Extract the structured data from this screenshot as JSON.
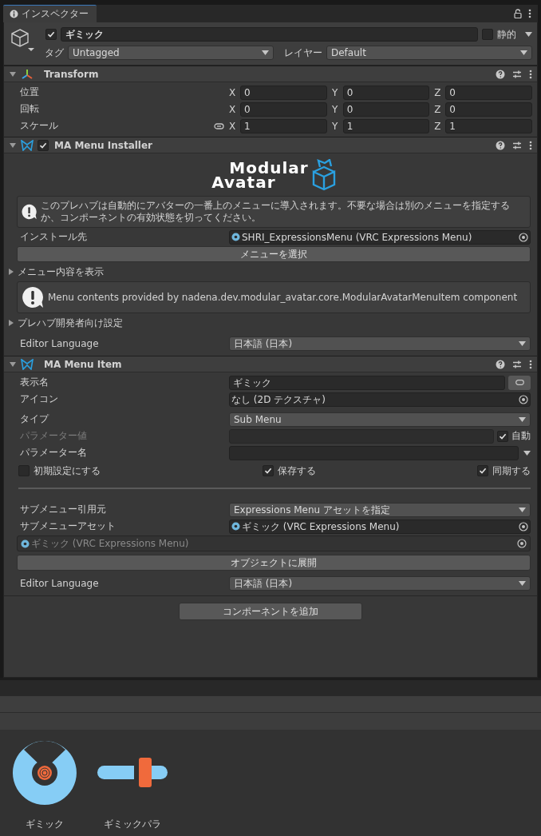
{
  "tab": {
    "title": "インスペクター",
    "selected": true
  },
  "object": {
    "active": true,
    "name": "ギミック",
    "static": false,
    "static_label": "静的",
    "tag_label": "タグ",
    "tag": "Untagged",
    "layer_label": "レイヤー",
    "layer": "Default"
  },
  "components": [
    {
      "kind": "transform",
      "title": "Transform",
      "expanded": true,
      "rows": [
        {
          "kind": "vector",
          "label": "位置",
          "fields": [
            {
              "axis": "X",
              "value": "0"
            },
            {
              "axis": "Y",
              "value": "0"
            },
            {
              "axis": "Z",
              "value": "0"
            }
          ]
        },
        {
          "kind": "vector",
          "label": "回転",
          "fields": [
            {
              "axis": "X",
              "value": "0"
            },
            {
              "axis": "Y",
              "value": "0"
            },
            {
              "axis": "Z",
              "value": "0"
            }
          ]
        },
        {
          "kind": "scale",
          "label": "スケール",
          "fields": [
            {
              "axis": "X",
              "value": "1"
            },
            {
              "axis": "Y",
              "value": "1"
            },
            {
              "axis": "Z",
              "value": "1"
            }
          ]
        }
      ]
    },
    {
      "kind": "modular_avatar",
      "title": "MA Menu Installer",
      "enabled": true,
      "expanded": true,
      "logo": {
        "line1": "Modular",
        "line2": "Avatar"
      },
      "rows": [
        {
          "kind": "help",
          "text": "このプレハブは自動的にアバターの一番上のメニューに導入されます。不要な場合は別のメニューを指定するか、コンポーネントの有効状態を切ってください。"
        },
        {
          "kind": "object_field",
          "label": "インストール先",
          "value": "SHRI_ExpressionsMenu (VRC Expressions Menu)"
        },
        {
          "kind": "button",
          "text": "メニューを選択"
        },
        {
          "kind": "foldout",
          "label": "メニュー内容を表示",
          "expanded": false
        },
        {
          "kind": "help",
          "text": "Menu contents provided by nadena.dev.modular_avatar.core.ModularAvatarMenuItem component"
        },
        {
          "kind": "foldout",
          "label": "プレハブ開発者向け設定",
          "expanded": false
        },
        {
          "kind": "dropdown",
          "label": "Editor Language",
          "value": "日本語 (日本)"
        }
      ]
    },
    {
      "kind": "modular_avatar",
      "title": "MA Menu Item",
      "expanded": true,
      "rows": [
        {
          "kind": "name_field",
          "label": "表示名",
          "value": "ギミック"
        },
        {
          "kind": "texture_field",
          "label": "アイコン",
          "value": "なし (2D テクスチャ)"
        },
        {
          "kind": "dropdown",
          "label": "タイプ",
          "value": "Sub Menu"
        },
        {
          "kind": "auto_value",
          "label": "パラメーター値",
          "disabled": true,
          "auto_label": "自動",
          "auto": true
        },
        {
          "kind": "combo_field",
          "label": "パラメーター名"
        },
        {
          "kind": "toggles",
          "items": [
            {
              "label": "初期設定にする",
              "checked": false
            },
            {
              "label": "保存する",
              "checked": true
            },
            {
              "label": "同期する",
              "checked": true
            }
          ]
        },
        {
          "kind": "separator"
        },
        {
          "kind": "dropdown",
          "label": "サブメニュー引用元",
          "value": "Expressions Menu アセットを指定"
        },
        {
          "kind": "object_field",
          "label": "サブメニューアセット",
          "value": "ギミック (VRC Expressions Menu)"
        },
        {
          "kind": "object_preview",
          "value": "ギミック (VRC Expressions Menu)",
          "disabled": true
        },
        {
          "kind": "button",
          "text": "オブジェクトに展開"
        },
        {
          "kind": "dropdown",
          "label": "Editor Language",
          "value": "日本語 (日本)"
        }
      ]
    }
  ],
  "add_component": "コンポーネントを追加",
  "assets": [
    {
      "kind": "menu",
      "name": "ギミック"
    },
    {
      "kind": "parameters",
      "name": "ギミックパラ"
    }
  ]
}
